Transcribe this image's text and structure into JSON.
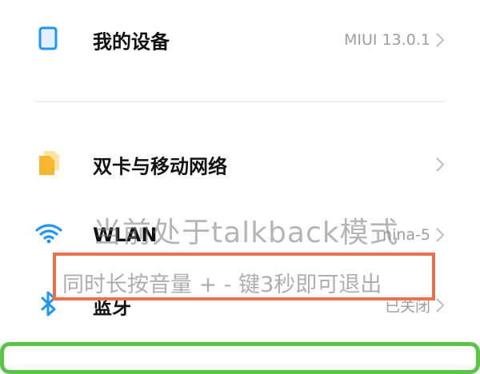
{
  "rows": [
    {
      "label": "我的设备",
      "value": "MIUI 13.0.1 ",
      "icon": "phone-icon"
    },
    {
      "label": "双卡与移动网络",
      "value": "",
      "icon": "sim-cards-icon"
    },
    {
      "label": "WLAN",
      "value": "nina-5",
      "icon": "wifi-icon"
    },
    {
      "label": "蓝牙",
      "value": "已关闭",
      "icon": "bluetooth-icon"
    }
  ],
  "overlay": {
    "title": "当前处于talkback模式",
    "subtitle": "同时长按音量 + - 键3秒即可退出",
    "box_color": "#e8724a"
  },
  "colors": {
    "accent_blue": "#2196f3",
    "sim_yellow": "#f7b731",
    "focus_green": "#59c446"
  }
}
